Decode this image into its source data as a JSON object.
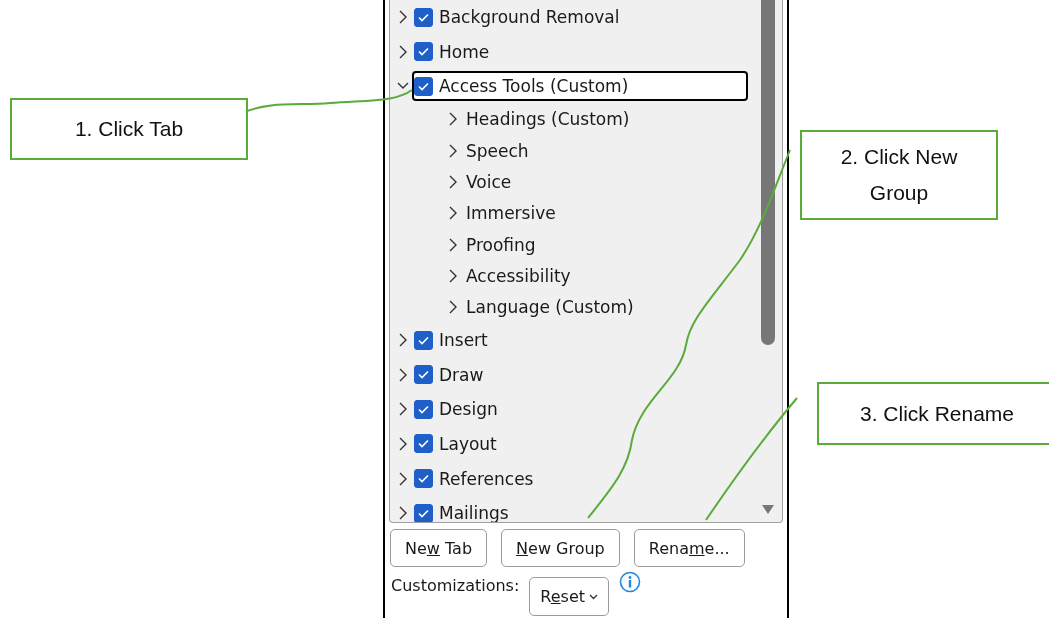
{
  "tabs_tree": [
    {
      "label": "Background Removal",
      "checked": true,
      "expanded": false,
      "selected": false
    },
    {
      "label": "Home",
      "checked": true,
      "expanded": false,
      "selected": false
    },
    {
      "label": "Access Tools (Custom)",
      "checked": true,
      "expanded": true,
      "selected": true,
      "children": [
        {
          "label": "Headings (Custom)",
          "expanded": false
        },
        {
          "label": "Speech",
          "expanded": false
        },
        {
          "label": "Voice",
          "expanded": false
        },
        {
          "label": "Immersive",
          "expanded": false
        },
        {
          "label": "Proofing",
          "expanded": false
        },
        {
          "label": "Accessibility",
          "expanded": false
        },
        {
          "label": "Language (Custom)",
          "expanded": false
        }
      ]
    },
    {
      "label": "Insert",
      "checked": true,
      "expanded": false,
      "selected": false
    },
    {
      "label": "Draw",
      "checked": true,
      "expanded": false,
      "selected": false
    },
    {
      "label": "Design",
      "checked": true,
      "expanded": false,
      "selected": false
    },
    {
      "label": "Layout",
      "checked": true,
      "expanded": false,
      "selected": false
    },
    {
      "label": "References",
      "checked": true,
      "expanded": false,
      "selected": false
    },
    {
      "label": "Mailings",
      "checked": true,
      "expanded": false,
      "selected": false
    }
  ],
  "buttons": [
    {
      "before": "Ne",
      "key": "w",
      "after": " Tab"
    },
    {
      "key": "N",
      "after": "ew Group"
    },
    {
      "before": "Rena",
      "key": "m",
      "after": "e..."
    }
  ],
  "customizations": {
    "label": "Customizations:",
    "reset": {
      "before": "R",
      "key": "e",
      "after": "set"
    }
  },
  "callouts": [
    "1. Click Tab",
    "2. Click New Group",
    "3. Click Rename"
  ]
}
